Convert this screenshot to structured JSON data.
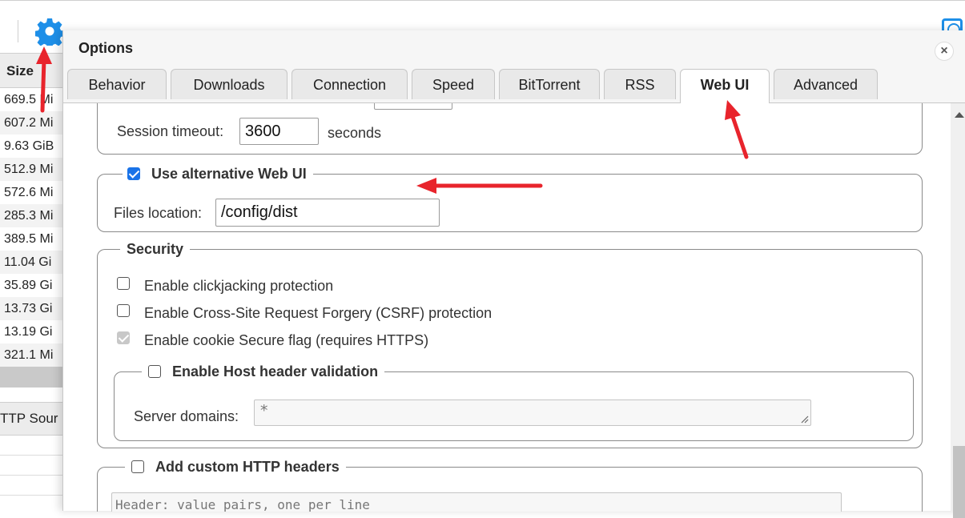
{
  "background": {
    "column_header": "Size",
    "sizes": [
      "669.5 Mi",
      "607.2 Mi",
      "9.63 GiB",
      "512.9 Mi",
      "572.6 Mi",
      "285.3 Mi",
      "389.5 Mi",
      "11.04 Gi",
      "35.89 Gi",
      "13.73 Gi",
      "13.19 Gi",
      "321.1 Mi"
    ],
    "tab_label": "TTP Sour"
  },
  "dialog": {
    "title": "Options",
    "close": "×",
    "tabs": [
      "Behavior",
      "Downloads",
      "Connection",
      "Speed",
      "BitTorrent",
      "RSS",
      "Web UI",
      "Advanced"
    ],
    "active_tab": "Web UI"
  },
  "session": {
    "label": "Session timeout:",
    "value": "3600",
    "unit": "seconds"
  },
  "alt_webui": {
    "legend": "Use alternative Web UI",
    "checked": true,
    "files_label": "Files location:",
    "files_value": "/config/dist"
  },
  "security": {
    "legend": "Security",
    "options": [
      {
        "label": "Enable clickjacking protection",
        "checked": false
      },
      {
        "label": "Enable Cross-Site Request Forgery (CSRF) protection",
        "checked": false
      },
      {
        "label": "Enable cookie Secure flag (requires HTTPS)",
        "checked": true,
        "disabled": true
      }
    ],
    "host_header": {
      "legend": "Enable Host header validation",
      "checked": false,
      "domains_label": "Server domains:",
      "domains_value": "*"
    }
  },
  "custom_headers": {
    "legend": "Add custom HTTP headers",
    "checked": false,
    "placeholder": "Header: value pairs, one per line"
  },
  "colors": {
    "accent": "#1a73e8",
    "annotation_arrow": "#e8242c"
  }
}
